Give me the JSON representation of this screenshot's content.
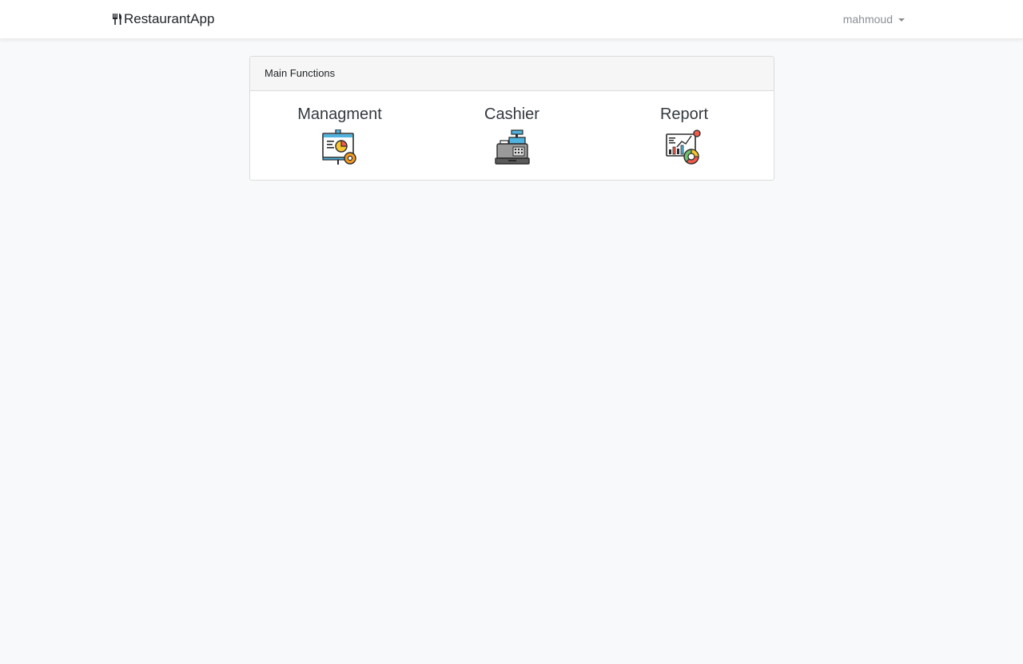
{
  "navbar": {
    "brand_icon": "utensils-icon",
    "brand_text": "RestaurantApp",
    "user_name": "mahmoud"
  },
  "card": {
    "header": "Main Functions",
    "functions": [
      {
        "label": "Managment",
        "icon": "management-presentation-icon"
      },
      {
        "label": "Cashier",
        "icon": "cash-register-icon"
      },
      {
        "label": "Report",
        "icon": "report-analytics-icon"
      }
    ]
  },
  "colors": {
    "background": "#f8f9fb",
    "navbar": "#ffffff",
    "card_header": "#f6f6f6",
    "muted_text": "#8a8f95"
  }
}
